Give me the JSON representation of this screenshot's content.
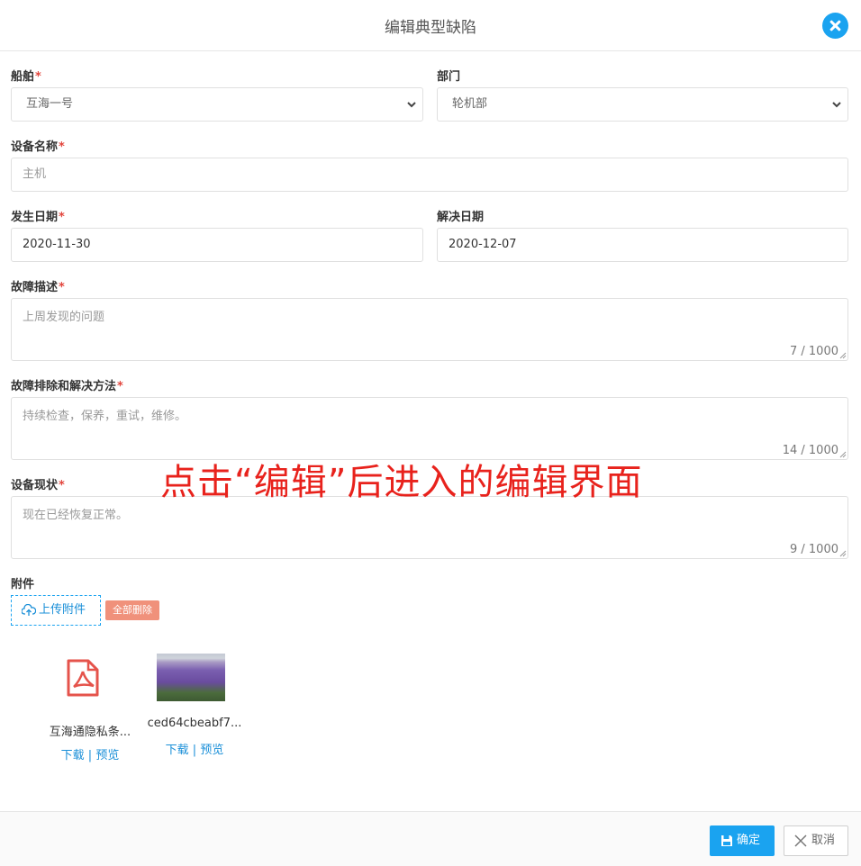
{
  "dialog": {
    "title": "编辑典型缺陷",
    "close_icon": "close-icon"
  },
  "form": {
    "ship": {
      "label": "船舶",
      "required": "*",
      "value": "互海一号"
    },
    "department": {
      "label": "部门",
      "value": "轮机部"
    },
    "equipment_name": {
      "label": "设备名称",
      "required": "*",
      "placeholder": "主机"
    },
    "occur_date": {
      "label": "发生日期",
      "required": "*",
      "value": "2020-11-30"
    },
    "resolve_date": {
      "label": "解决日期",
      "value": "2020-12-07"
    },
    "fault_description": {
      "label": "故障描述",
      "required": "*",
      "placeholder": "上周发现的问题",
      "counter": "7 / 1000"
    },
    "troubleshooting": {
      "label": "故障排除和解决方法",
      "required": "*",
      "placeholder": "持续检查，保养，重试，维修。",
      "counter": "14 / 1000"
    },
    "equipment_status": {
      "label": "设备现状",
      "required": "*",
      "placeholder": "现在已经恢复正常。",
      "counter": "9 / 1000"
    }
  },
  "attachments": {
    "label": "附件",
    "upload_label": "上传附件",
    "delete_all_label": "全部删除",
    "files": [
      {
        "name": "互海通隐私条...",
        "icon": "pdf-file-icon",
        "download": "下载",
        "separator": " | ",
        "preview": "预览"
      },
      {
        "name": "ced64cbeabf7...",
        "icon": "image-thumbnail",
        "download": "下载",
        "separator": " | ",
        "preview": "预览"
      }
    ]
  },
  "annotation": {
    "text": "点击“编辑”后进入的编辑界面"
  },
  "footer": {
    "confirm_label": "确定",
    "cancel_label": "取消"
  },
  "colors": {
    "accent": "#1aa3f0",
    "required": "#e2453c",
    "danger_soft": "#f0917b",
    "annotation": "#e8221c"
  }
}
